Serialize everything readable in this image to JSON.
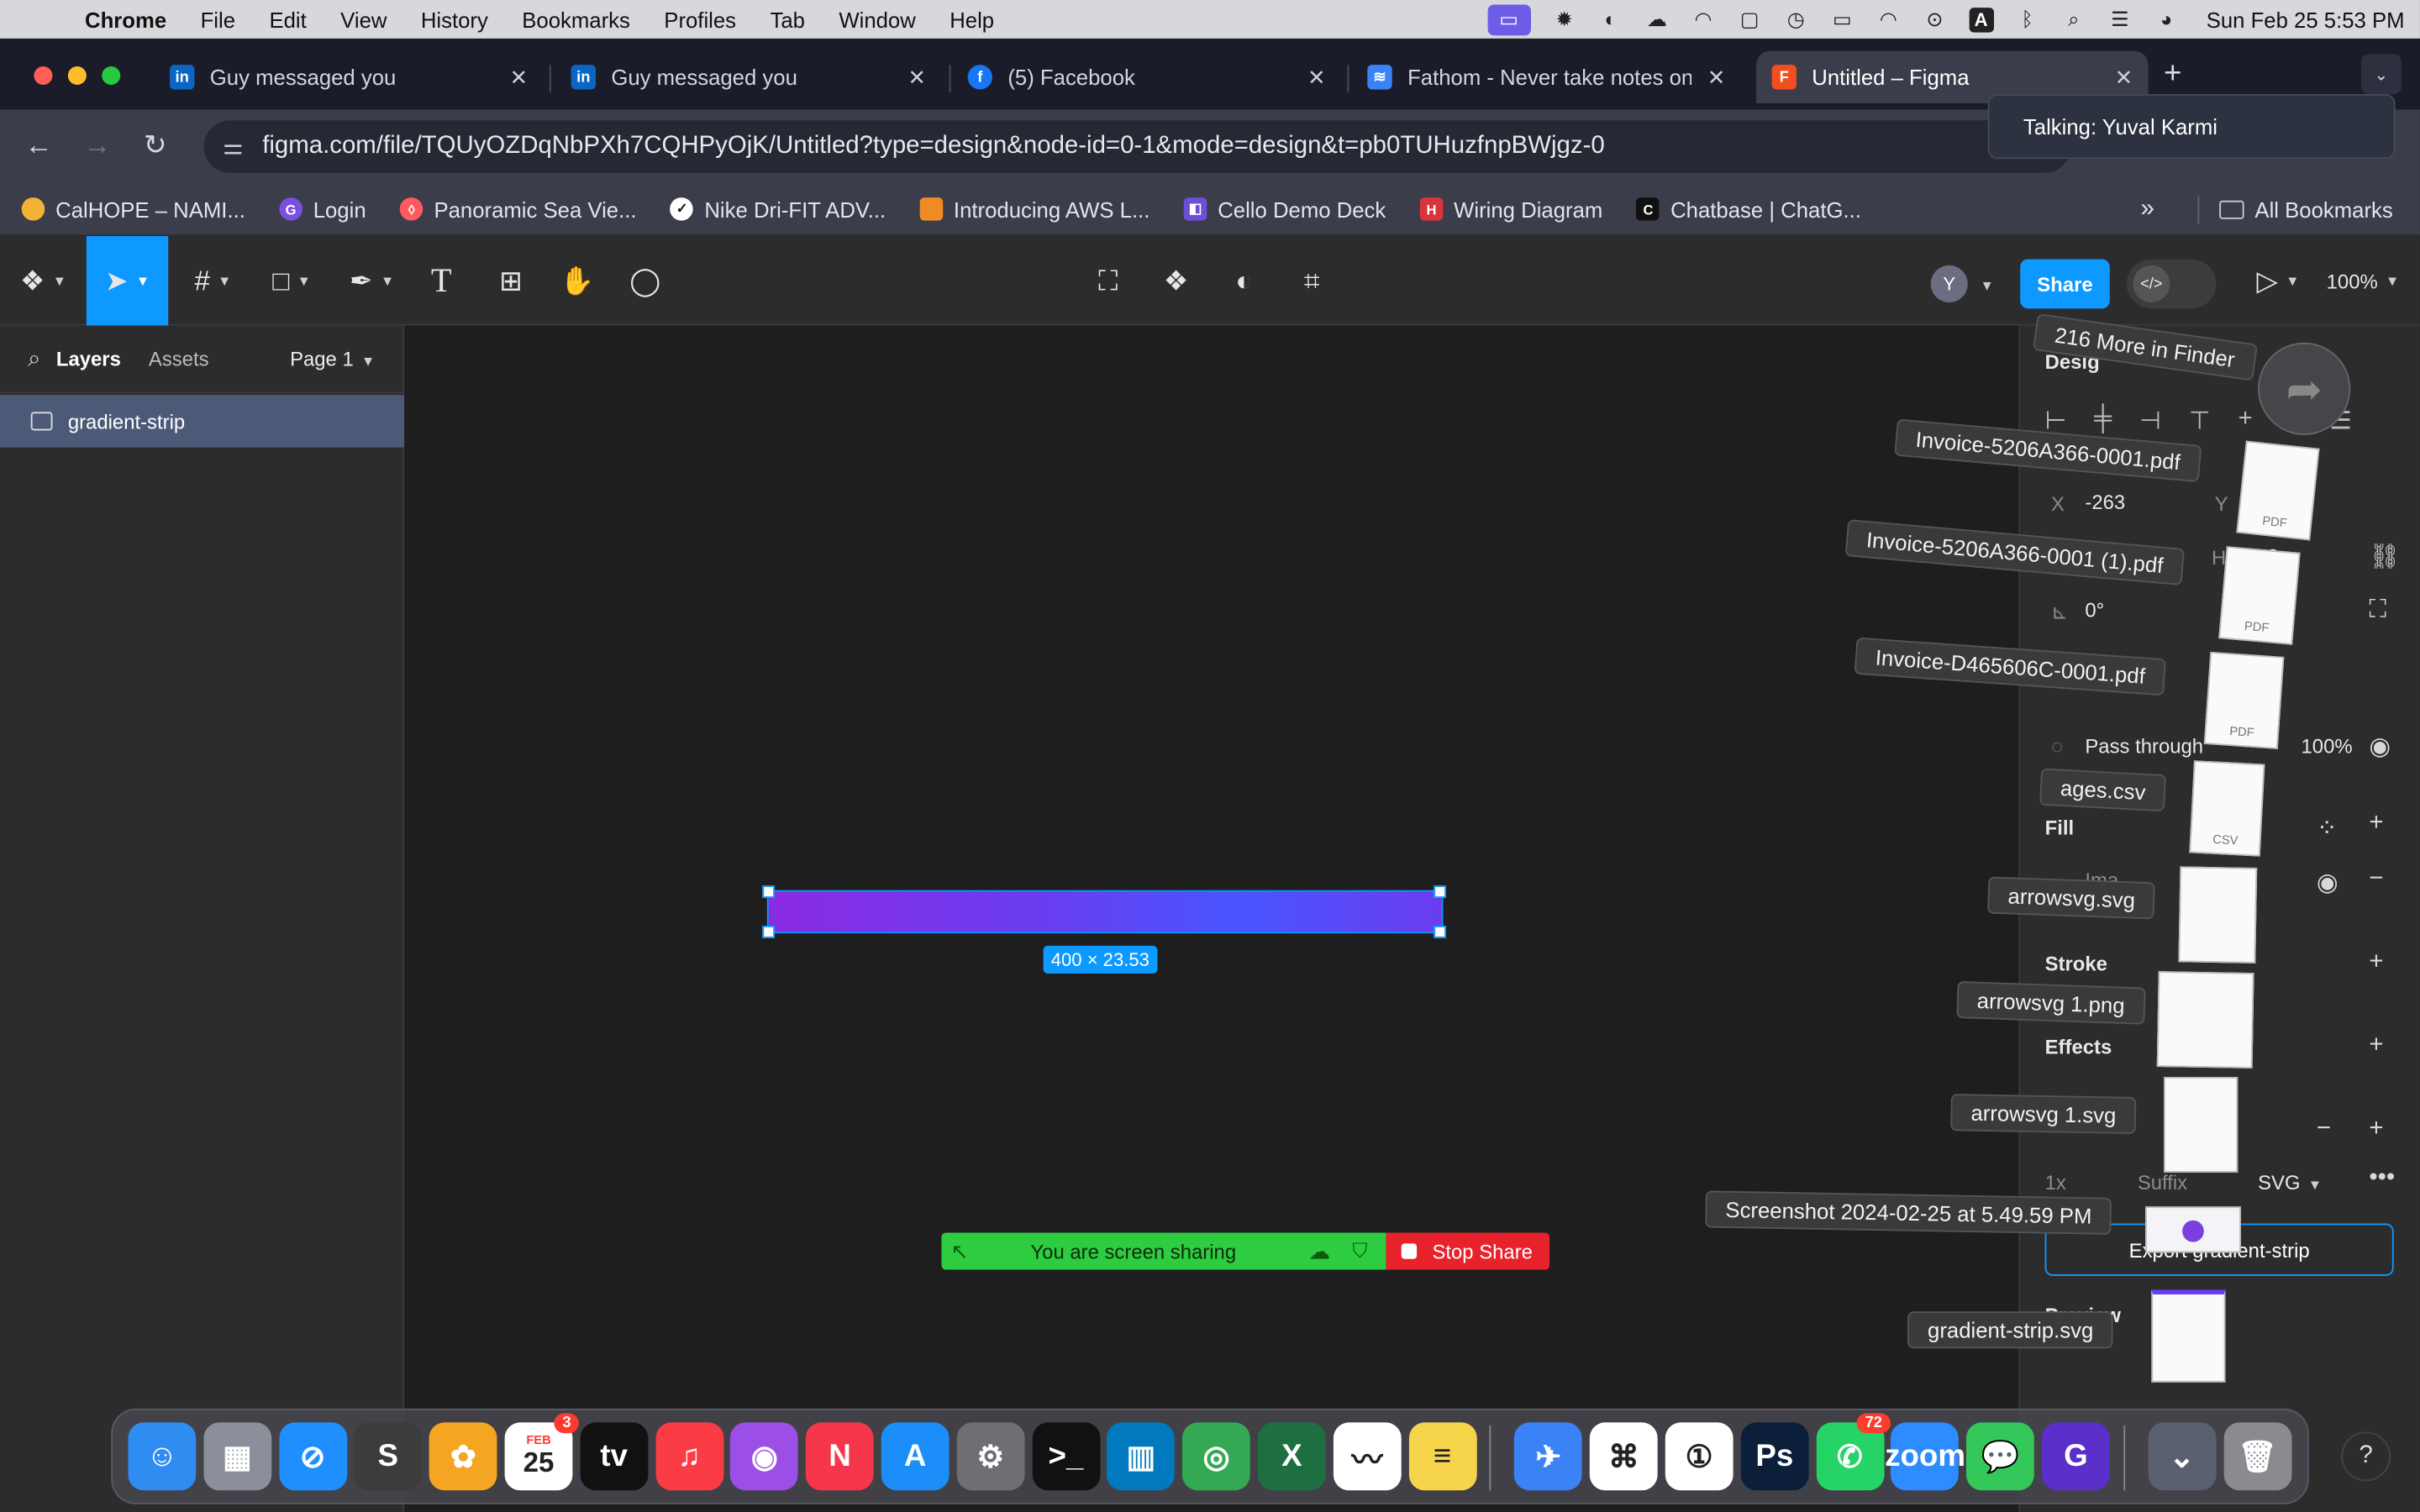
{
  "menubar": {
    "app": "Chrome",
    "items": [
      "File",
      "Edit",
      "View",
      "History",
      "Bookmarks",
      "Profiles",
      "Tab",
      "Window",
      "Help"
    ],
    "clock": "Sun Feb 25  5:53 PM",
    "input_indicator": "A"
  },
  "tabs": [
    {
      "title": "Guy messaged you",
      "favicon": "linkedin-icon"
    },
    {
      "title": "Guy messaged you",
      "favicon": "linkedin-icon"
    },
    {
      "title": "(5) Facebook",
      "favicon": "facebook-icon"
    },
    {
      "title": "Fathom - Never take notes on",
      "favicon": "fathom-icon"
    },
    {
      "title": "Untitled – Figma",
      "favicon": "figma-icon",
      "active": true
    }
  ],
  "address": {
    "url": "figma.com/file/TQUyOZDqNbPXh7CQHPyOjK/Untitled?type=design&node-id=0-1&mode=design&t=pb0TUHuzfnpBWjgz-0"
  },
  "toast": {
    "text": "Talking: Yuval Karmi"
  },
  "bookmarks": {
    "items": [
      {
        "label": "CalHOPE – NAMI...",
        "color": "#f2b233"
      },
      {
        "label": "Login",
        "color": "#7b4fe0"
      },
      {
        "label": "Panoramic Sea Vie...",
        "color": "#ff5a5f"
      },
      {
        "label": "Nike Dri-FIT ADV...",
        "color": "#ffffff"
      },
      {
        "label": "Introducing AWS L...",
        "color": "#f08a24"
      },
      {
        "label": "Cello Demo Deck",
        "color": "#6c4fd8"
      },
      {
        "label": "Wiring Diagram",
        "color": "#d9343b"
      },
      {
        "label": "Chatbase | ChatG...",
        "color": "#111111"
      }
    ],
    "overflow": "»",
    "all_bookmarks": "All Bookmarks"
  },
  "figma": {
    "share_label": "Share",
    "avatar_initial": "Y",
    "zoom": "100%",
    "left": {
      "tab_layers": "Layers",
      "tab_assets": "Assets",
      "page": "Page 1",
      "layer_name": "gradient-strip"
    },
    "canvas": {
      "dimensions": "400 × 23.53",
      "gradient_colors": [
        "#8a2be2",
        "#4a55ff"
      ]
    },
    "right": {
      "design_label": "Desig",
      "x_label": "X",
      "x_value": "-263",
      "y_label": "Y",
      "h_label": "H",
      "h_value": "3.53",
      "rotation": "0°",
      "blend": "Pass through",
      "opacity": "100%",
      "fill_label": "Fill",
      "fill_value": "Ima...",
      "stroke_label": "Stroke",
      "effects_label": "Effects",
      "export_scale": "1x",
      "export_suffix": "Suffix",
      "export_format": "SVG",
      "export_button": "Export gradient-strip",
      "preview_label": "Preview"
    }
  },
  "screen_share": {
    "text": "You are screen sharing",
    "stop": "Stop Share"
  },
  "dragged_files": {
    "more": "216 More in Finder",
    "files": [
      "Invoice-5206A366-0001.pdf",
      "Invoice-5206A366-0001 (1).pdf",
      "Invoice-D465606C-0001.pdf",
      "ages.csv",
      "arrowsvg.svg",
      "arrowsvg 1.png",
      "arrowsvg 1.svg",
      "Screenshot 2024-02-25 at 5.49.59 PM",
      "gradient-strip.svg"
    ],
    "thumb_labels": [
      "PDF",
      "PDF",
      "PDF",
      "CSV"
    ]
  },
  "dock": {
    "apps": [
      {
        "name": "Finder",
        "glyph": "☺",
        "color": "#2f8cf0"
      },
      {
        "name": "Launchpad",
        "glyph": "▦",
        "color": "#8a8f99"
      },
      {
        "name": "Safari",
        "glyph": "⊘",
        "color": "#1f8fff"
      },
      {
        "name": "Sublime",
        "glyph": "S",
        "color": "#3c3c3c"
      },
      {
        "name": "Photos",
        "glyph": "✿",
        "color": "#f4a623"
      },
      {
        "name": "Calendar",
        "glyph": "25",
        "color": "#ffffff"
      },
      {
        "name": "TV",
        "glyph": "tv",
        "color": "#111111"
      },
      {
        "name": "Music",
        "glyph": "♫",
        "color": "#fc3c44"
      },
      {
        "name": "Podcasts",
        "glyph": "◉",
        "color": "#9b4fe6"
      },
      {
        "name": "News",
        "glyph": "N",
        "color": "#f5364b"
      },
      {
        "name": "App Store",
        "glyph": "A",
        "color": "#1c8ef9"
      },
      {
        "name": "System Settings",
        "glyph": "⚙",
        "color": "#6e6e73"
      },
      {
        "name": "Terminal",
        "glyph": ">_",
        "color": "#111111"
      },
      {
        "name": "Trello",
        "glyph": "▥",
        "color": "#0079bf"
      },
      {
        "name": "Chrome",
        "glyph": "◎",
        "color": "#34a853"
      },
      {
        "name": "Excel",
        "glyph": "X",
        "color": "#1d6f42"
      },
      {
        "name": "Freeform",
        "glyph": "〰",
        "color": "#ffffff"
      },
      {
        "name": "Notes",
        "glyph": "≡",
        "color": "#f7d54a"
      },
      {
        "name": "Mimestream",
        "glyph": "✈",
        "color": "#3b82f6"
      },
      {
        "name": "VS Code",
        "glyph": "⌘",
        "color": "#ffffff"
      },
      {
        "name": "1Password",
        "glyph": "①",
        "color": "#ffffff"
      },
      {
        "name": "Photoshop",
        "glyph": "Ps",
        "color": "#0b1f3a"
      },
      {
        "name": "WhatsApp",
        "glyph": "✆",
        "color": "#25d366"
      },
      {
        "name": "Zoom",
        "glyph": "zoom",
        "color": "#2d8cff"
      },
      {
        "name": "Messages",
        "glyph": "💬",
        "color": "#34c759"
      },
      {
        "name": "Grammarly",
        "glyph": "G",
        "color": "#5b2fc9"
      },
      {
        "name": "Downloads",
        "glyph": "⌄",
        "color": "#5a6070"
      },
      {
        "name": "Trash",
        "glyph": "🗑",
        "color": "#8a8a90"
      }
    ],
    "calendar_month": "FEB",
    "badges": {
      "calendar": "3",
      "whatsapp": "72"
    }
  },
  "help_label": "?"
}
